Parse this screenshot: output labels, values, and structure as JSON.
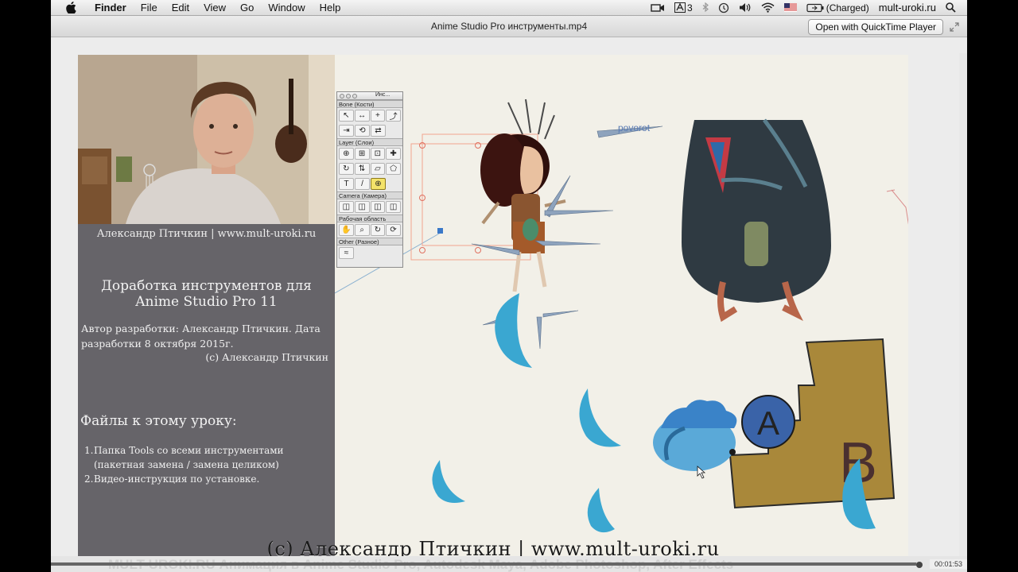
{
  "menubar": {
    "app": "Finder",
    "menus": [
      "File",
      "Edit",
      "View",
      "Go",
      "Window",
      "Help"
    ],
    "input_badge": "3",
    "battery": "(Charged)",
    "user": "mult-uroki.ru"
  },
  "player": {
    "title": "Anime Studio Pro инструменты.mp4",
    "open_button": "Open with QuickTime Player",
    "time": "00:01:53",
    "progress": 0.998
  },
  "left_panel": {
    "author_caption": "Александр Птичкин | www.mult-uroki.ru",
    "lesson_title_1": "Доработка инструментов для",
    "lesson_title_2": "Anime Studio Pro 11",
    "lesson_author": "Автор разработки: Александр Птичкин. Дата разработки 8 октября 2015г.",
    "lesson_copy": "(с) Александр Птичкин",
    "files_title": "Файлы к этому уроку:",
    "files": [
      {
        "num": "1.",
        "text": "Папка Tools со всеми инструментами (пакетная замена / замена целиком)"
      },
      {
        "num": "2.",
        "text": "Видео-инструкция по установке."
      }
    ]
  },
  "palette": {
    "title": "Инс...",
    "sections": {
      "bone": "Bone (Кости)",
      "layer": "Layer (Слои)",
      "camera": "Camera (Камера)",
      "workspace": "Рабочая область",
      "other": "Other (Разное)"
    }
  },
  "scene": {
    "bone_label": "povorot",
    "letter_a": "A",
    "letter_b": "B",
    "watermark": "(с) Александр Птичкин | www.mult-uroki.ru"
  },
  "bottom": {
    "scrub_text": "MULT-UROKI.RU   Анимация в Anime Studio Pro, Autodesk Maya, Adobe Photoshop, After Effects"
  },
  "colors": {
    "panel": "#666469",
    "canvas": "#f2f0e8",
    "bag": "#2f3a42",
    "letter_box": "#a9883a",
    "feather": "#3aa7d1",
    "circle_a": "#3a63a8"
  }
}
